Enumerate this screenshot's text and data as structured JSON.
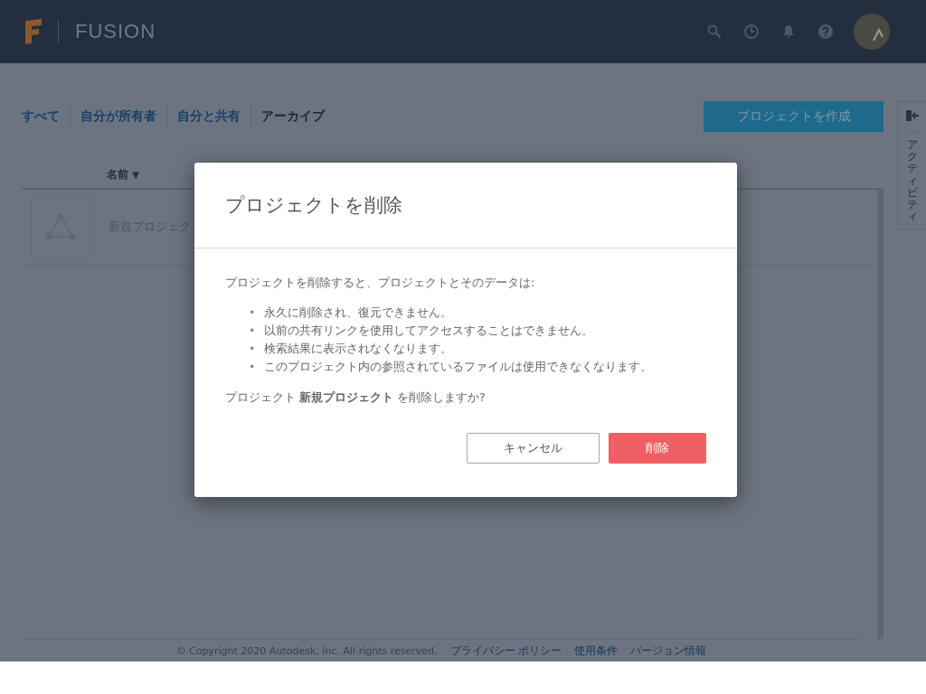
{
  "header": {
    "product": "FUSION"
  },
  "tabs": [
    {
      "label": "すべて",
      "selected": false
    },
    {
      "label": "自分が所有者",
      "selected": false
    },
    {
      "label": "自分と共有",
      "selected": false
    },
    {
      "label": "アーカイブ",
      "selected": true
    }
  ],
  "create_button": "プロジェクトを作成",
  "side_panel": {
    "label": "アクティビティ"
  },
  "table": {
    "columns": [
      {
        "label": "名前",
        "sort": "▼"
      }
    ],
    "rows": [
      {
        "name": "新規プロジェク"
      }
    ]
  },
  "footer": {
    "copyright": "© Copyright 2020 Autodesk, Inc. All rights reserved.",
    "links": [
      "プライバシー ポリシー",
      "使用条件",
      "バージョン情報"
    ]
  },
  "dialog": {
    "title": "プロジェクトを削除",
    "intro": "プロジェクトを削除すると、プロジェクトとそのデータは:",
    "bullet_marker": "•",
    "bullets": [
      "永久に削除され、復元できません。",
      "以前の共有リンクを使用してアクセスすることはできません。",
      "検索結果に表示されなくなります。",
      "このプロジェクト内の参照されているファイルは使用できなくなります。"
    ],
    "confirm": "プロジェクト **新規プロジェクト** を削除しますか?",
    "buttons": [
      {
        "label": "キャンセル",
        "kind": "secondary"
      },
      {
        "label": "削除",
        "kind": "danger"
      }
    ]
  }
}
